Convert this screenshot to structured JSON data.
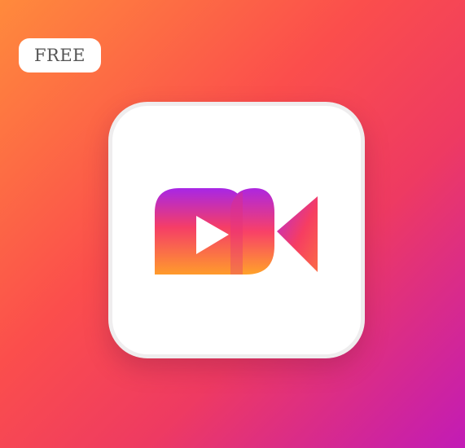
{
  "badge": {
    "label": "FREE"
  },
  "icon": {
    "name": "video-camera-icon",
    "colors": {
      "background_top_left": "#ff8a3c",
      "background_bottom_right": "#c21bb6",
      "logo_orange": "#ff9b2c",
      "logo_pink": "#fa3d63",
      "logo_purple": "#a726e6"
    }
  }
}
